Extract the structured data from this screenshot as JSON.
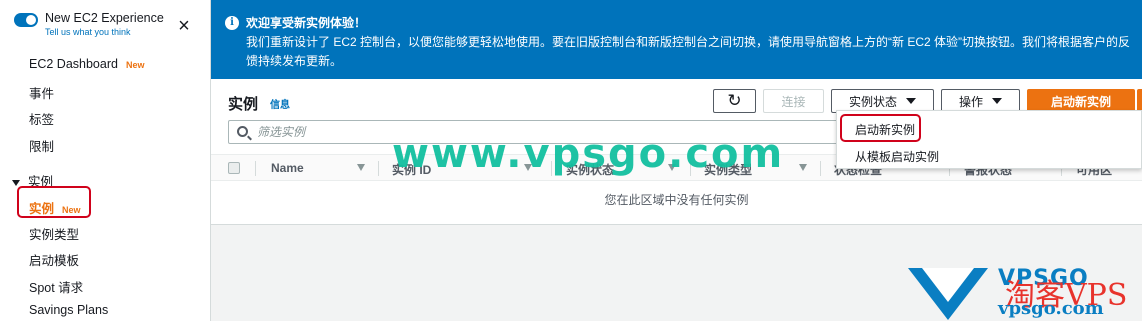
{
  "sidebar": {
    "toggle_title": "New EC2 Experience",
    "toggle_subtitle": "Tell us what you think",
    "close_icon": "×",
    "items": [
      {
        "label": "EC2 Dashboard",
        "badge": "New"
      },
      {
        "label": "事件"
      },
      {
        "label": "标签"
      },
      {
        "label": "限制"
      }
    ],
    "section": "实例",
    "section_items": [
      {
        "label": "实例",
        "badge": "New",
        "active": true
      },
      {
        "label": "实例类型"
      },
      {
        "label": "启动模板"
      },
      {
        "label": "Spot 请求"
      },
      {
        "label": "Savings Plans"
      }
    ]
  },
  "banner": {
    "icon": "i",
    "title": "欢迎享受新实例体验！",
    "body": "我们重新设计了 EC2 控制台，以便您能够更轻松地使用。要在旧版控制台和新版控制台之间切换，请使用导航窗格上方的“新 EC2 体验”切换按钮。我们将根据客户的反馈持续发布更新。"
  },
  "panel": {
    "title": "实例",
    "info": "信息",
    "refresh_icon": "↻",
    "connect_label": "连接",
    "instance_state_label": "实例状态",
    "actions_label": "操作",
    "launch_label": "启动新实例",
    "search_placeholder": "筛选实例",
    "columns": [
      "Name",
      "实例 ID",
      "实例状态",
      "实例类型",
      "状态检查",
      "警报状态",
      "可用区"
    ],
    "empty_message": "您在此区域中没有任何实例"
  },
  "dropdown": {
    "items": [
      "启动新实例",
      "从模板启动实例"
    ]
  },
  "watermark": {
    "main": "www.vpsgo.com",
    "logo_text": "VPSGO",
    "logo_cn": "淘客VPS",
    "logo_url": "vpsgo.com"
  },
  "colors": {
    "accent_blue": "#0073bb",
    "primary_orange": "#ec7211",
    "highlight_red": "#d0021b",
    "watermark_green": "#13c0a0"
  }
}
